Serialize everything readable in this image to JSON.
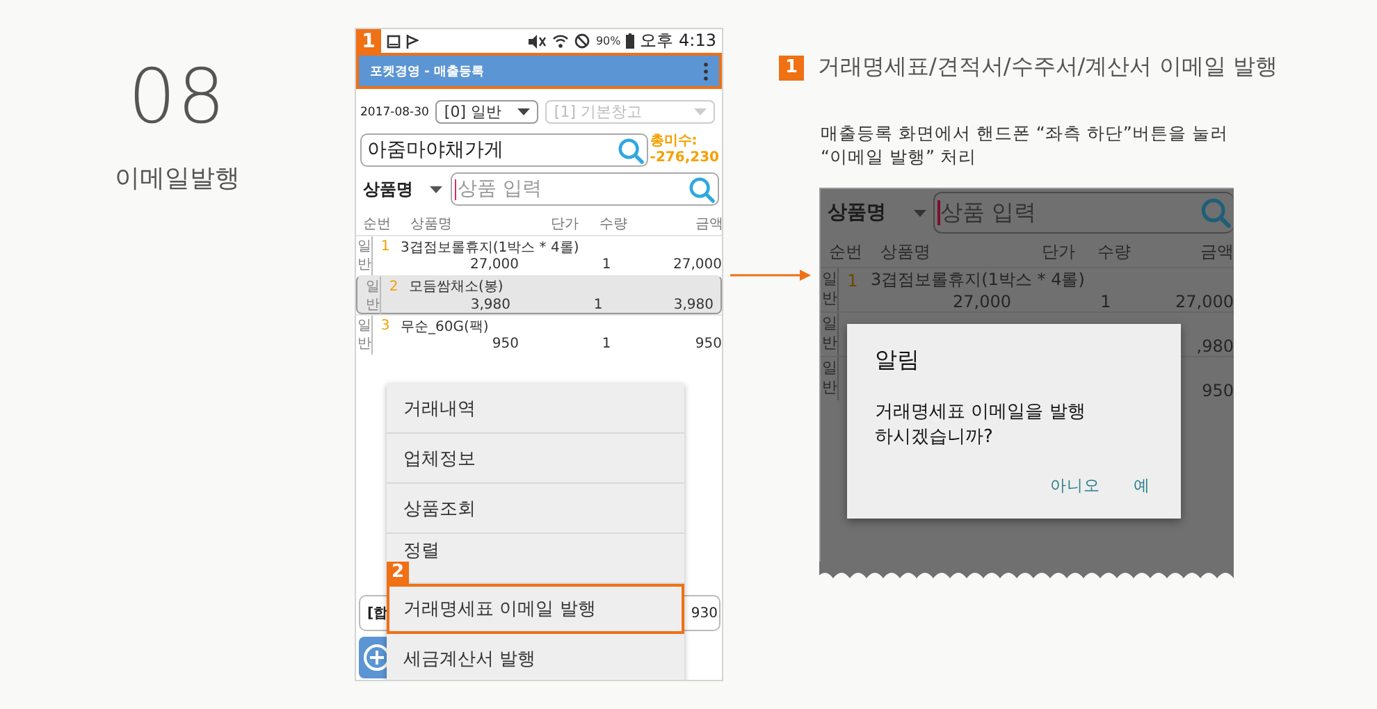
{
  "section": {
    "number": "08",
    "title": "이메일발행"
  },
  "phone": {
    "step_badge": "1",
    "status_bar": {
      "battery": "90%",
      "time": "오후 4:13"
    },
    "app_bar": {
      "title": "포켓경영 - 매출등록"
    },
    "date": "2017-08-30",
    "type_select": {
      "value": "[0] 일반",
      "disabled": false
    },
    "warehouse_select": {
      "value": "[1] 기본창고",
      "disabled": true
    },
    "customer_field": {
      "value": "아줌마야채가게"
    },
    "balance": {
      "label": "총미수:",
      "value": "-276,230"
    },
    "search_mode": "상품명",
    "product_field": {
      "placeholder": "상품 입력"
    },
    "table": {
      "columns": [
        "순번",
        "상품명",
        "단가",
        "수량",
        "금액"
      ],
      "rows": [
        {
          "type": "일반",
          "no": "1",
          "name": "3겹점보롤휴지(1박스 * 4롤)",
          "price": "27,000",
          "qty": "1",
          "amount": "27,000",
          "selected": false
        },
        {
          "type": "일반",
          "no": "2",
          "name": "모듬쌈채소(봉)",
          "price": "3,980",
          "qty": "1",
          "amount": "3,980",
          "selected": true
        },
        {
          "type": "일반",
          "no": "3",
          "name": "무순_60G(팩)",
          "price": "950",
          "qty": "1",
          "amount": "950",
          "selected": false
        }
      ]
    },
    "total_bar": {
      "label": "[합",
      "value": "930"
    },
    "menu": {
      "items": [
        {
          "label": "거래내역",
          "highlighted": false
        },
        {
          "label": "업체정보",
          "highlighted": false
        },
        {
          "label": "상품조회",
          "highlighted": false
        },
        {
          "label": "정렬",
          "highlighted": false
        },
        {
          "label": "거래명세표 이메일 발행",
          "highlighted": true,
          "badge": "2"
        },
        {
          "label": "세금계산서 발행",
          "highlighted": false
        }
      ]
    }
  },
  "callout": {
    "badge": "1",
    "title": "거래명세표/견적서/수주서/계산서 이메일 발행",
    "description": [
      "매출등록 화면에서 핸드폰 “좌측 하단”버튼을 눌러",
      "“이메일 발행” 처리"
    ]
  },
  "screenshot": {
    "search_mode": "상품명",
    "product_field": {
      "placeholder": "상품 입력"
    },
    "columns": [
      "순번",
      "상품명",
      "단가",
      "수량",
      "금액"
    ],
    "rows": [
      {
        "type": "일반",
        "no": "1",
        "name": "3겹점보롤휴지(1박스 * 4롤)",
        "price": "27,000",
        "qty": "1",
        "amount": "27,000"
      },
      {
        "type": "일반",
        "amount": ",980"
      },
      {
        "type": "일반",
        "amount": "950"
      }
    ],
    "dialog": {
      "title": "알림",
      "message": "거래명세표 이메일을 발행\n하시겠습니까?",
      "buttons": [
        "아니오",
        "예"
      ]
    }
  }
}
